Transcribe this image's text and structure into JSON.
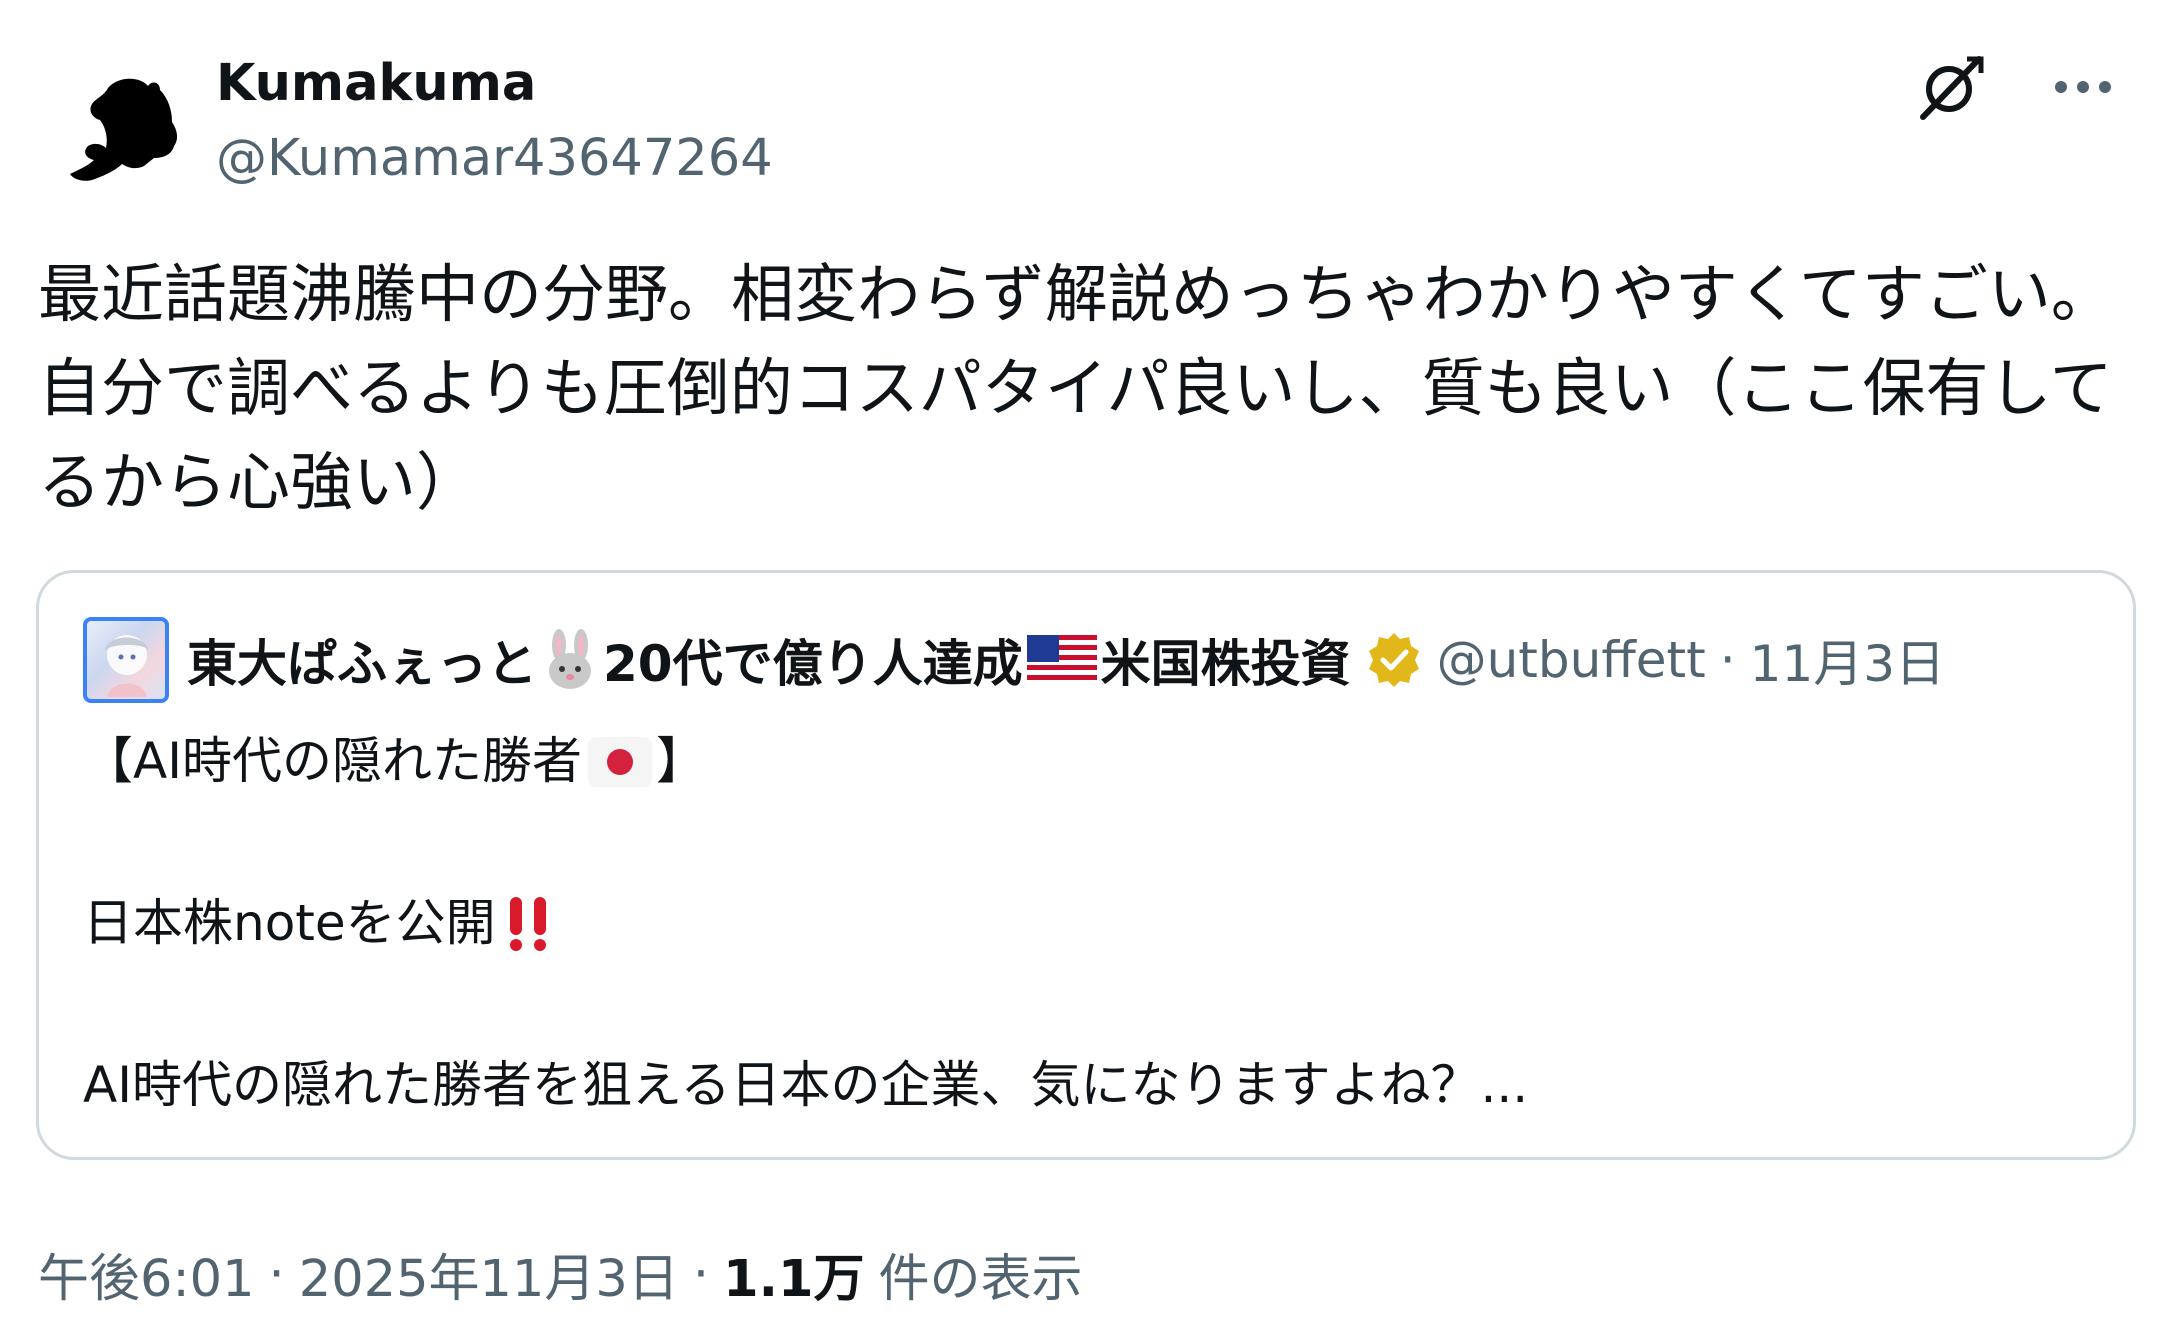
{
  "author": {
    "name": "Kumakuma",
    "handle": "@Kumamar43647264",
    "avatar_icon": "black-bear-silhouette-icon"
  },
  "actions": {
    "grok_icon": "slashed-circle-icon",
    "more_icon": "more-dots-icon"
  },
  "tweet": {
    "text": "最近話題沸騰中の分野。相変わらず解説めっちゃわかりやすくてすごい。\n自分で調べるよりも圧倒的コスパタイパ良いし、質も良い（ここ保有して\nるから心強い）"
  },
  "quote": {
    "name_part1": "東大ぱふぇっと",
    "name_part2": "20代で億り人達成",
    "name_part3": "米国株投資",
    "handle": "@utbuffett",
    "separator": "·",
    "date": "11月3日",
    "line1_pre": "【AI時代の隠れた勝者",
    "line1_post": "】",
    "line2": "日本株noteを公開",
    "line3": "AI時代の隠れた勝者を狙える日本の企業、気になりますよね？...",
    "verified_color": "#e2b719"
  },
  "meta": {
    "time": "午後6:01",
    "date": "2025年11月3日",
    "views_count": "1.1万",
    "views_label": "件の表示",
    "separator": "·"
  }
}
